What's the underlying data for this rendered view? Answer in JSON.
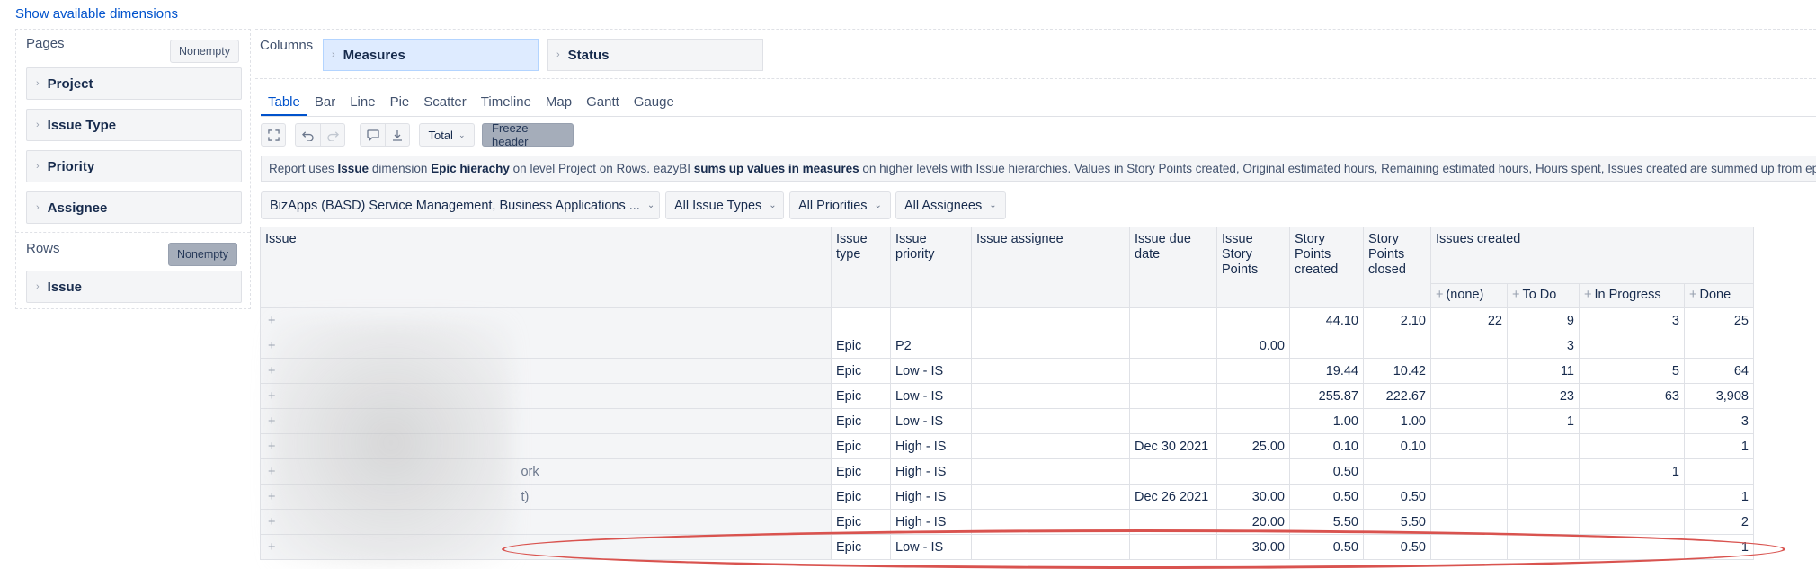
{
  "show_dimensions_link": "Show available dimensions",
  "pages": {
    "label": "Pages",
    "nonempty_label": "Nonempty",
    "dimensions": [
      "Project",
      "Issue Type",
      "Priority",
      "Assignee"
    ]
  },
  "rows": {
    "label": "Rows",
    "nonempty_label": "Nonempty",
    "dimensions": [
      "Issue"
    ]
  },
  "columns": {
    "label": "Columns",
    "items": [
      {
        "label": "Measures"
      },
      {
        "label": "Status"
      }
    ]
  },
  "tabs": [
    "Table",
    "Bar",
    "Line",
    "Pie",
    "Scatter",
    "Timeline",
    "Map",
    "Gantt",
    "Gauge"
  ],
  "active_tab": "Table",
  "toolbar": {
    "total_label": "Total",
    "freeze_label": "Freeze header"
  },
  "info": {
    "p1": "Report uses ",
    "b1": "Issue",
    "p2": " dimension ",
    "b2": "Epic hierachy",
    "p3": " on level Project on Rows. eazyBI ",
    "b3": "sums up values in measures",
    "p4": " on higher levels with Issue hierarchies. Values in Story Points created, Original estimated hours, Remaining estimated hours, Hours spent, Issues created are summed up from epic"
  },
  "filters": [
    "BizApps (BASD) Service Management, Business Applications ...",
    "All Issue Types",
    "All Priorities",
    "All Assignees"
  ],
  "table": {
    "headers": {
      "issue": "Issue",
      "issue_type": "Issue type",
      "issue_priority": "Issue priority",
      "issue_assignee": "Issue assignee",
      "issue_due_date": "Issue due date",
      "issue_story_points": "Issue Story Points",
      "sp_created": "Story Points created",
      "sp_closed": "Story Points closed",
      "issues_created": "Issues created"
    },
    "status_headers": [
      "(none)",
      "To Do",
      "In Progress",
      "Done"
    ],
    "rows": [
      {
        "issue": "",
        "type": "",
        "priority": "",
        "due": "",
        "isp": "",
        "spc": "44.10",
        "spcl": "2.10",
        "none": "22",
        "todo": "9",
        "inprog": "3",
        "done": "25"
      },
      {
        "issue": "",
        "type": "Epic",
        "priority": "P2",
        "due": "",
        "isp": "0.00",
        "spc": "",
        "spcl": "",
        "none": "",
        "todo": "3",
        "inprog": "",
        "done": ""
      },
      {
        "issue": "",
        "type": "Epic",
        "priority": "Low - IS",
        "due": "",
        "isp": "",
        "spc": "19.44",
        "spcl": "10.42",
        "none": "",
        "todo": "11",
        "inprog": "5",
        "done": "64"
      },
      {
        "issue": "",
        "type": "Epic",
        "priority": "Low - IS",
        "due": "",
        "isp": "",
        "spc": "255.87",
        "spcl": "222.67",
        "none": "",
        "todo": "23",
        "inprog": "63",
        "done": "3,908"
      },
      {
        "issue": "",
        "type": "Epic",
        "priority": "Low - IS",
        "due": "",
        "isp": "",
        "spc": "1.00",
        "spcl": "1.00",
        "none": "",
        "todo": "1",
        "inprog": "",
        "done": "3"
      },
      {
        "issue": "",
        "type": "Epic",
        "priority": "High - IS",
        "due": "Dec 30 2021",
        "isp": "25.00",
        "spc": "0.10",
        "spcl": "0.10",
        "none": "",
        "todo": "",
        "inprog": "",
        "done": "1"
      },
      {
        "issue": "ork",
        "type": "Epic",
        "priority": "High - IS",
        "due": "",
        "isp": "",
        "spc": "0.50",
        "spcl": "",
        "none": "",
        "todo": "",
        "inprog": "1",
        "done": ""
      },
      {
        "issue": "t)",
        "type": "Epic",
        "priority": "High - IS",
        "due": "Dec 26 2021",
        "isp": "30.00",
        "spc": "0.50",
        "spcl": "0.50",
        "none": "",
        "todo": "",
        "inprog": "",
        "done": "1"
      },
      {
        "issue": "",
        "type": "Epic",
        "priority": "High - IS",
        "due": "",
        "isp": "20.00",
        "spc": "5.50",
        "spcl": "5.50",
        "none": "",
        "todo": "",
        "inprog": "",
        "done": "2"
      },
      {
        "issue": "",
        "type": "Epic",
        "priority": "Low - IS",
        "due": "",
        "isp": "30.00",
        "spc": "0.50",
        "spcl": "0.50",
        "none": "",
        "todo": "",
        "inprog": "",
        "done": "1"
      }
    ]
  }
}
